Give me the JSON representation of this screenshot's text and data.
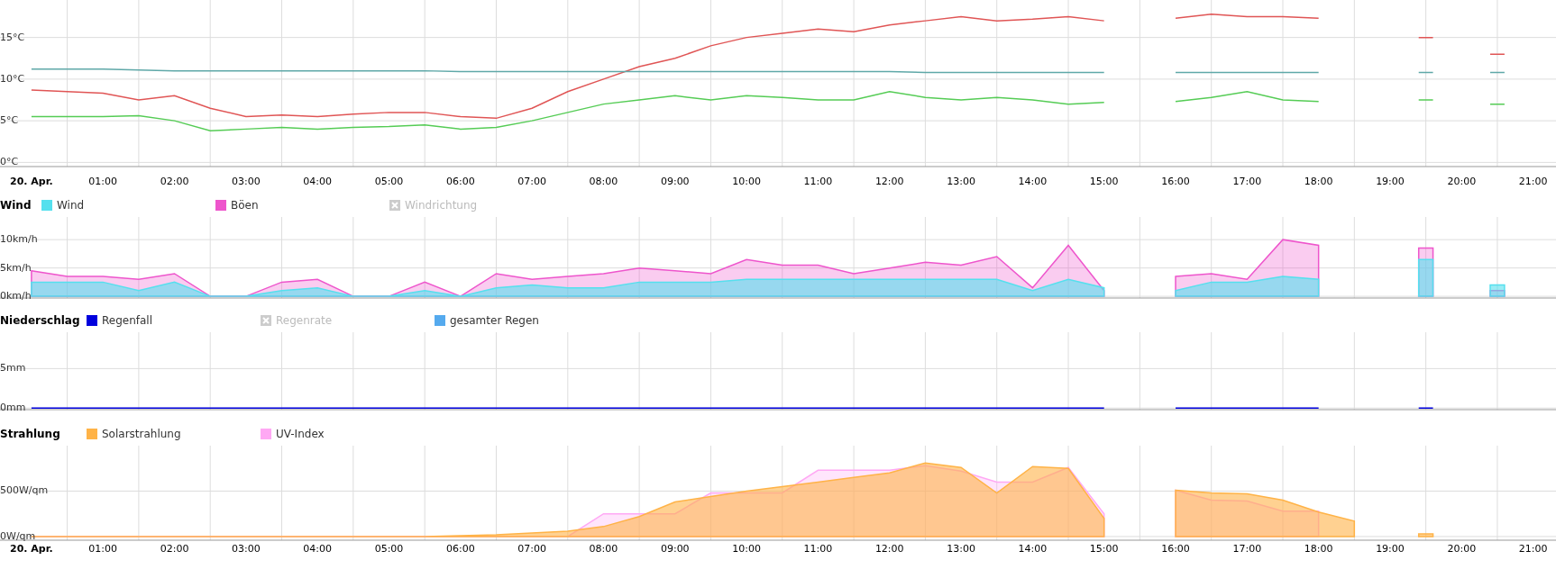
{
  "temperature": {
    "chart_data": {
      "type": "line",
      "grid": true,
      "xlim": [
        -0.44,
        21.32
      ],
      "ylim": [
        -0.5,
        19.5
      ],
      "x": [
        0,
        0.5,
        1,
        1.5,
        2,
        2.5,
        3,
        3.5,
        4,
        4.5,
        5,
        5.5,
        6,
        6.5,
        7,
        7.5,
        8,
        8.5,
        9,
        9.5,
        10,
        10.5,
        11,
        11.5,
        12,
        12.5,
        13,
        13.5,
        14,
        14.5,
        15,
        16,
        16.5,
        17,
        17.5,
        18,
        19.4,
        19.6,
        20.4,
        20.6
      ],
      "series": [
        {
          "color": "#e05555",
          "values": [
            8.7,
            8.5,
            8.3,
            7.5,
            8.0,
            6.5,
            5.5,
            5.7,
            5.5,
            5.8,
            6.0,
            6.0,
            5.5,
            5.3,
            6.5,
            8.5,
            10,
            11.5,
            12.5,
            14,
            15,
            15.5,
            16,
            15.7,
            16.5,
            17,
            17.5,
            17.0,
            17.2,
            17.5,
            17.0,
            17.3,
            17.8,
            17.5,
            17.5,
            17.3,
            15.0,
            15.0,
            13.0,
            13.0
          ]
        },
        {
          "color": "#5fa8a8",
          "values": [
            11.2,
            11.2,
            11.2,
            11.1,
            11.0,
            11.0,
            11.0,
            11.0,
            11.0,
            11.0,
            11.0,
            11.0,
            10.9,
            10.9,
            10.9,
            10.9,
            10.9,
            10.9,
            10.9,
            10.9,
            10.9,
            10.9,
            10.9,
            10.9,
            10.9,
            10.8,
            10.8,
            10.8,
            10.8,
            10.8,
            10.8,
            10.8,
            10.8,
            10.8,
            10.8,
            10.8,
            10.8,
            10.8,
            10.8,
            10.8
          ]
        },
        {
          "color": "#55cc55",
          "values": [
            5.5,
            5.5,
            5.5,
            5.6,
            5.0,
            3.8,
            4.0,
            4.2,
            4.0,
            4.2,
            4.3,
            4.5,
            4.0,
            4.2,
            5.0,
            6.0,
            7.0,
            7.5,
            8.0,
            7.5,
            8.0,
            7.8,
            7.5,
            7.5,
            8.5,
            7.8,
            7.5,
            7.8,
            7.5,
            7.0,
            7.2,
            7.3,
            7.8,
            8.5,
            7.5,
            7.3,
            7.5,
            7.5,
            7.0,
            7.0
          ]
        }
      ],
      "yticks": [
        {
          "value": 0,
          "label": "0°C"
        },
        {
          "value": 5,
          "label": "5°C"
        },
        {
          "value": 10,
          "label": "10°C"
        },
        {
          "value": 15,
          "label": "15°C"
        }
      ],
      "xticks": [
        {
          "value": 0,
          "label": "20. Apr."
        },
        {
          "value": 1,
          "label": "01:00"
        },
        {
          "value": 2,
          "label": "02:00"
        },
        {
          "value": 3,
          "label": "03:00"
        },
        {
          "value": 4,
          "label": "04:00"
        },
        {
          "value": 5,
          "label": "05:00"
        },
        {
          "value": 6,
          "label": "06:00"
        },
        {
          "value": 7,
          "label": "07:00"
        },
        {
          "value": 8,
          "label": "08:00"
        },
        {
          "value": 9,
          "label": "09:00"
        },
        {
          "value": 10,
          "label": "10:00"
        },
        {
          "value": 11,
          "label": "11:00"
        },
        {
          "value": 12,
          "label": "12:00"
        },
        {
          "value": 13,
          "label": "13:00"
        },
        {
          "value": 14,
          "label": "14:00"
        },
        {
          "value": 15,
          "label": "15:00"
        },
        {
          "value": 16,
          "label": "16:00"
        },
        {
          "value": 17,
          "label": "17:00"
        },
        {
          "value": 18,
          "label": "18:00"
        },
        {
          "value": 19,
          "label": "19:00"
        },
        {
          "value": 20,
          "label": "20:00"
        },
        {
          "value": 21,
          "label": "21:00"
        }
      ]
    }
  },
  "wind": {
    "title": "Wind",
    "legend": [
      {
        "label": "Wind",
        "color": "#55e0ee",
        "visible": true
      },
      {
        "label": "Böen",
        "color": "#ee55cc",
        "visible": true
      },
      {
        "label": "Windrichtung",
        "color": "#cccccc",
        "visible": false
      }
    ],
    "chart_data": {
      "type": "area",
      "grid": true,
      "xlim": [
        -0.44,
        21.32
      ],
      "ylim": [
        -0.3,
        14
      ],
      "x": [
        0,
        0.5,
        1,
        1.5,
        2,
        2.5,
        3,
        3.5,
        4,
        4.5,
        5,
        5.5,
        6,
        6.5,
        7,
        7.5,
        8,
        8.5,
        9,
        9.5,
        10,
        10.5,
        11,
        11.5,
        12,
        12.5,
        13,
        13.5,
        14,
        14.5,
        15,
        16,
        16.5,
        17,
        17.5,
        18,
        19.4,
        19.6,
        20.4,
        20.6
      ],
      "series": [
        {
          "color": "#ee55cc",
          "values": [
            4.5,
            3.5,
            3.5,
            3,
            4,
            0,
            0,
            2.5,
            3,
            0,
            0,
            2.5,
            0,
            4,
            3,
            3.5,
            4,
            5,
            4.5,
            4,
            6.5,
            5.5,
            5.5,
            4,
            5,
            6,
            5.5,
            7,
            1.5,
            9,
            1,
            3.5,
            4,
            3,
            10,
            9,
            8.5,
            8.5,
            1,
            1
          ]
        },
        {
          "color": "#55e0ee",
          "values": [
            2.5,
            2.5,
            2.5,
            1,
            2.5,
            0,
            0,
            1,
            1.5,
            0,
            0,
            1,
            0,
            1.5,
            2,
            1.5,
            1.5,
            2.5,
            2.5,
            2.5,
            3,
            3,
            3,
            3,
            3,
            3,
            3,
            3,
            1,
            3,
            1.5,
            1,
            2.5,
            2.5,
            3.5,
            3,
            6.5,
            6.5,
            2,
            2
          ]
        }
      ],
      "yticks": [
        {
          "value": 0,
          "label": "0km/h"
        },
        {
          "value": 5,
          "label": "5km/h"
        },
        {
          "value": 10,
          "label": "10km/h"
        }
      ]
    }
  },
  "rain": {
    "title": "Niederschlag",
    "legend": [
      {
        "label": "Regenfall",
        "color": "#0000dd",
        "visible": true
      },
      {
        "label": "Regenrate",
        "color": "#cccccc",
        "visible": false
      },
      {
        "label": "gesamter Regen",
        "color": "#55aaee",
        "visible": true
      }
    ],
    "chart_data": {
      "type": "line",
      "grid": true,
      "xlim": [
        -0.44,
        21.32
      ],
      "ylim": [
        -0.2,
        9.6
      ],
      "x": [
        0,
        0.5,
        1,
        1.5,
        2,
        2.5,
        3,
        3.5,
        4,
        4.5,
        5,
        5.5,
        6,
        6.5,
        7,
        7.5,
        8,
        8.5,
        9,
        9.5,
        10,
        10.5,
        11,
        11.5,
        12,
        12.5,
        13,
        13.5,
        14,
        14.5,
        15,
        16,
        16.5,
        17,
        17.5,
        18,
        19.4,
        19.6
      ],
      "series": [
        {
          "color": "#0000dd",
          "values": [
            0,
            0,
            0,
            0,
            0,
            0,
            0,
            0,
            0,
            0,
            0,
            0,
            0,
            0,
            0,
            0,
            0,
            0,
            0,
            0,
            0,
            0,
            0,
            0,
            0,
            0,
            0,
            0,
            0,
            0,
            0,
            0,
            0,
            0,
            0,
            0,
            0,
            0
          ]
        }
      ],
      "yticks": [
        {
          "value": 0,
          "label": "0mm"
        },
        {
          "value": 5,
          "label": "5mm"
        }
      ]
    }
  },
  "radiation": {
    "title": "Strahlung",
    "legend": [
      {
        "label": "Solarstrahlung",
        "color": "#ffb347",
        "visible": true
      },
      {
        "label": "UV-Index",
        "color": "#ffa8f4",
        "visible": true
      }
    ],
    "chart_data": {
      "type": "area",
      "grid": true,
      "xlim": [
        -0.44,
        21.32
      ],
      "ylim": [
        -40,
        1000
      ],
      "x": [
        0,
        0.5,
        1,
        1.5,
        2,
        2.5,
        3,
        3.5,
        4,
        4.5,
        5,
        5.5,
        6,
        6.5,
        7,
        7.5,
        8,
        8.5,
        9,
        9.5,
        10,
        10.5,
        11,
        11.5,
        12,
        12.5,
        13,
        13.5,
        14,
        14.5,
        15,
        16,
        16.5,
        17,
        17.5,
        18,
        18.5,
        19.4,
        19.6
      ],
      "series": [
        {
          "color": "#ffa8f4",
          "values": [
            0,
            0,
            0,
            0,
            0,
            0,
            0,
            0,
            0,
            0,
            0,
            0,
            0,
            0,
            0,
            0,
            250,
            250,
            250,
            480,
            480,
            480,
            730,
            730,
            730,
            780,
            720,
            600,
            600,
            760,
            250,
            510,
            400,
            390,
            280,
            280,
            null,
            null,
            null
          ]
        },
        {
          "color": "#ffb347",
          "values": [
            0,
            0,
            0,
            0,
            0,
            0,
            0,
            0,
            0,
            0,
            0,
            0,
            10,
            20,
            40,
            60,
            110,
            220,
            380,
            440,
            500,
            550,
            600,
            650,
            700,
            810,
            760,
            480,
            770,
            750,
            200,
            510,
            480,
            470,
            400,
            270,
            170,
            30,
            30
          ]
        }
      ],
      "yticks": [
        {
          "value": 0,
          "label": "0W/qm"
        },
        {
          "value": 500,
          "label": "500W/qm"
        }
      ],
      "xticks": [
        {
          "value": 0,
          "label": "20. Apr."
        },
        {
          "value": 1,
          "label": "01:00"
        },
        {
          "value": 2,
          "label": "02:00"
        },
        {
          "value": 3,
          "label": "03:00"
        },
        {
          "value": 4,
          "label": "04:00"
        },
        {
          "value": 5,
          "label": "05:00"
        },
        {
          "value": 6,
          "label": "06:00"
        },
        {
          "value": 7,
          "label": "07:00"
        },
        {
          "value": 8,
          "label": "08:00"
        },
        {
          "value": 9,
          "label": "09:00"
        },
        {
          "value": 10,
          "label": "10:00"
        },
        {
          "value": 11,
          "label": "11:00"
        },
        {
          "value": 12,
          "label": "12:00"
        },
        {
          "value": 13,
          "label": "13:00"
        },
        {
          "value": 14,
          "label": "14:00"
        },
        {
          "value": 15,
          "label": "15:00"
        },
        {
          "value": 16,
          "label": "16:00"
        },
        {
          "value": 17,
          "label": "17:00"
        },
        {
          "value": 18,
          "label": "18:00"
        },
        {
          "value": 19,
          "label": "19:00"
        },
        {
          "value": 20,
          "label": "20:00"
        },
        {
          "value": 21,
          "label": "21:00"
        }
      ]
    }
  }
}
